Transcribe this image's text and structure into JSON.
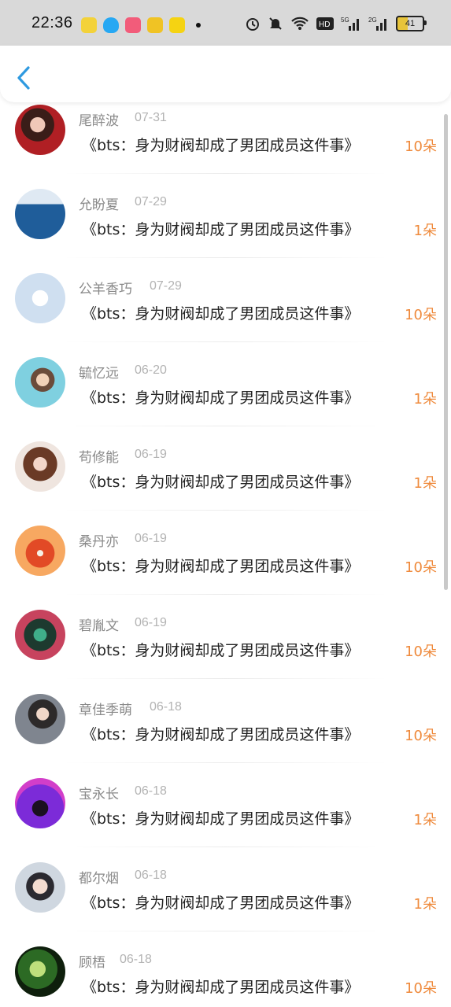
{
  "status_bar": {
    "time": "22:36",
    "battery": "41",
    "icons": [
      "alarm-icon",
      "mute-icon",
      "wifi-icon",
      "hd-icon",
      "signal-5g-icon",
      "signal-2g-icon"
    ]
  },
  "header": {
    "back_icon": "chevron-left-icon"
  },
  "list": {
    "items": [
      {
        "name": "尾醉波",
        "date": "07-31",
        "title": "《bts：身为财阀却成了男团成员这件事》",
        "amount": "10朵",
        "avatar": "avatar-1"
      },
      {
        "name": "允盼夏",
        "date": "07-29",
        "title": "《bts：身为财阀却成了男团成员这件事》",
        "amount": "1朵",
        "avatar": "avatar-2"
      },
      {
        "name": "公羊香巧",
        "date": "07-29",
        "title": "《bts：身为财阀却成了男团成员这件事》",
        "amount": "10朵",
        "avatar": "avatar-3"
      },
      {
        "name": "毓忆远",
        "date": "06-20",
        "title": "《bts：身为财阀却成了男团成员这件事》",
        "amount": "1朵",
        "avatar": "avatar-4"
      },
      {
        "name": "苟修能",
        "date": "06-19",
        "title": "《bts：身为财阀却成了男团成员这件事》",
        "amount": "1朵",
        "avatar": "avatar-5"
      },
      {
        "name": "桑丹亦",
        "date": "06-19",
        "title": "《bts：身为财阀却成了男团成员这件事》",
        "amount": "10朵",
        "avatar": "avatar-6"
      },
      {
        "name": "碧胤文",
        "date": "06-19",
        "title": "《bts：身为财阀却成了男团成员这件事》",
        "amount": "10朵",
        "avatar": "avatar-7"
      },
      {
        "name": "章佳季萌",
        "date": "06-18",
        "title": "《bts：身为财阀却成了男团成员这件事》",
        "amount": "10朵",
        "avatar": "avatar-8"
      },
      {
        "name": "宝永长",
        "date": "06-18",
        "title": "《bts：身为财阀却成了男团成员这件事》",
        "amount": "1朵",
        "avatar": "avatar-9"
      },
      {
        "name": "都尔烟",
        "date": "06-18",
        "title": "《bts：身为财阀却成了男团成员这件事》",
        "amount": "1朵",
        "avatar": "avatar-10"
      },
      {
        "name": "顾梧",
        "date": "06-18",
        "title": "《bts：身为财阀却成了男团成员这件事》",
        "amount": "10朵",
        "avatar": "avatar-11"
      }
    ]
  }
}
